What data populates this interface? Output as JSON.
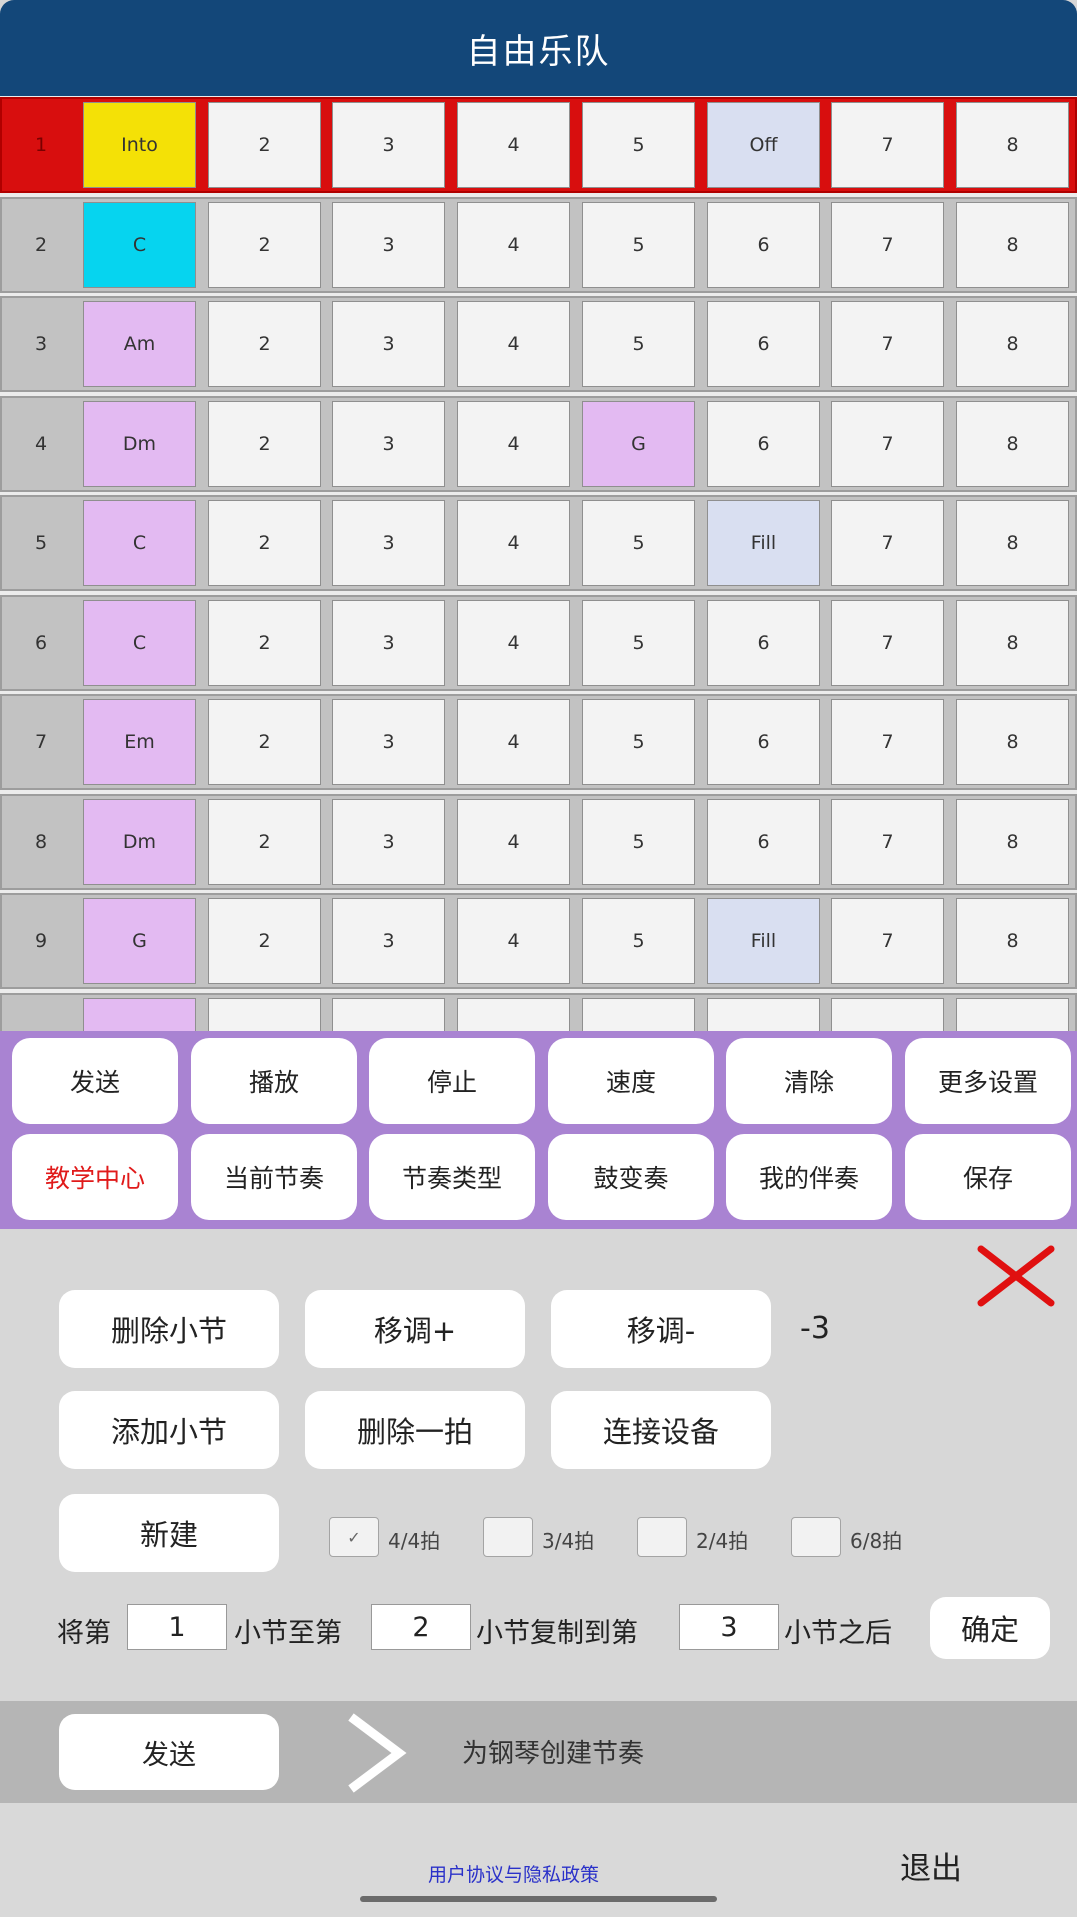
{
  "header": {
    "title": "自由乐队"
  },
  "grid": {
    "rows": [
      {
        "num": "1",
        "active": true,
        "cells": [
          {
            "label": "Into",
            "color": "yellow"
          },
          {
            "label": "2"
          },
          {
            "label": "3"
          },
          {
            "label": "4"
          },
          {
            "label": "5"
          },
          {
            "label": "Off",
            "color": "blue"
          },
          {
            "label": "7"
          },
          {
            "label": "8"
          }
        ]
      },
      {
        "num": "2",
        "active": false,
        "cells": [
          {
            "label": "C",
            "color": "cyan"
          },
          {
            "label": "2"
          },
          {
            "label": "3"
          },
          {
            "label": "4"
          },
          {
            "label": "5"
          },
          {
            "label": "6"
          },
          {
            "label": "7"
          },
          {
            "label": "8"
          }
        ]
      },
      {
        "num": "3",
        "active": false,
        "cells": [
          {
            "label": "Am",
            "color": "purple"
          },
          {
            "label": "2"
          },
          {
            "label": "3"
          },
          {
            "label": "4"
          },
          {
            "label": "5"
          },
          {
            "label": "6"
          },
          {
            "label": "7"
          },
          {
            "label": "8"
          }
        ]
      },
      {
        "num": "4",
        "active": false,
        "cells": [
          {
            "label": "Dm",
            "color": "purple"
          },
          {
            "label": "2"
          },
          {
            "label": "3"
          },
          {
            "label": "4"
          },
          {
            "label": "G",
            "color": "purple"
          },
          {
            "label": "6"
          },
          {
            "label": "7"
          },
          {
            "label": "8"
          }
        ]
      },
      {
        "num": "5",
        "active": false,
        "cells": [
          {
            "label": "C",
            "color": "purple"
          },
          {
            "label": "2"
          },
          {
            "label": "3"
          },
          {
            "label": "4"
          },
          {
            "label": "5"
          },
          {
            "label": "Fill",
            "color": "blue"
          },
          {
            "label": "7"
          },
          {
            "label": "8"
          }
        ]
      },
      {
        "num": "6",
        "active": false,
        "cells": [
          {
            "label": "C",
            "color": "purple"
          },
          {
            "label": "2"
          },
          {
            "label": "3"
          },
          {
            "label": "4"
          },
          {
            "label": "5"
          },
          {
            "label": "6"
          },
          {
            "label": "7"
          },
          {
            "label": "8"
          }
        ]
      },
      {
        "num": "7",
        "active": false,
        "cells": [
          {
            "label": "Em",
            "color": "purple"
          },
          {
            "label": "2"
          },
          {
            "label": "3"
          },
          {
            "label": "4"
          },
          {
            "label": "5"
          },
          {
            "label": "6"
          },
          {
            "label": "7"
          },
          {
            "label": "8"
          }
        ]
      },
      {
        "num": "8",
        "active": false,
        "cells": [
          {
            "label": "Dm",
            "color": "purple"
          },
          {
            "label": "2"
          },
          {
            "label": "3"
          },
          {
            "label": "4"
          },
          {
            "label": "5"
          },
          {
            "label": "6"
          },
          {
            "label": "7"
          },
          {
            "label": "8"
          }
        ]
      },
      {
        "num": "9",
        "active": false,
        "cells": [
          {
            "label": "G",
            "color": "purple"
          },
          {
            "label": "2"
          },
          {
            "label": "3"
          },
          {
            "label": "4"
          },
          {
            "label": "5"
          },
          {
            "label": "Fill",
            "color": "blue"
          },
          {
            "label": "7"
          },
          {
            "label": "8"
          }
        ]
      },
      {
        "num": "",
        "active": false,
        "cells": [
          {
            "label": "",
            "color": "purple"
          },
          {
            "label": ""
          },
          {
            "label": ""
          },
          {
            "label": ""
          },
          {
            "label": ""
          },
          {
            "label": ""
          },
          {
            "label": ""
          },
          {
            "label": ""
          }
        ]
      }
    ]
  },
  "menu": {
    "row1": [
      "发送",
      "播放",
      "停止",
      "速度",
      "清除",
      "更多设置"
    ],
    "row2": [
      "教学中心",
      "当前节奏",
      "节奏类型",
      "鼓变奏",
      "我的伴奏",
      "保存"
    ]
  },
  "panel": {
    "delete_bar": "删除小节",
    "transpose_up": "移调+",
    "transpose_down": "移调-",
    "transpose_value": "-3",
    "add_bar": "添加小节",
    "delete_beat": "删除一拍",
    "connect_device": "连接设备",
    "new": "新建",
    "time_signatures": [
      {
        "label": "4/4拍",
        "checked": true
      },
      {
        "label": "3/4拍",
        "checked": false
      },
      {
        "label": "2/4拍",
        "checked": false
      },
      {
        "label": "6/8拍",
        "checked": false
      }
    ],
    "copy": {
      "prefix": "将第",
      "from": "1",
      "mid1": "小节至第",
      "to": "2",
      "mid2": "小节复制到第",
      "target": "3",
      "suffix": "小节之后",
      "confirm": "确定"
    },
    "checkmark": "✓"
  },
  "sendbar": {
    "send": "发送",
    "text": "为钢琴创建节奏"
  },
  "footer": {
    "privacy": "用户协议与隐私政策",
    "logout": "退出"
  },
  "colors": {
    "header": "#134779",
    "active_row": "#d80e0e",
    "menu_bg": "#a983d2",
    "yellow": "#f4e106",
    "cyan": "#06d4ef",
    "purple": "#e3baf2",
    "close_x": "#e01010"
  }
}
